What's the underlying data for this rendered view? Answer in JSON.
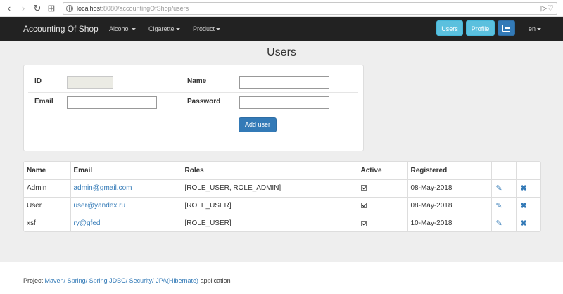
{
  "browser": {
    "back_glyph": "‹",
    "forward_glyph": "›",
    "reload_glyph": "↻",
    "tabs_glyph": "⊞",
    "url_host": "localhost",
    "url_rest": ":8080/accountingOfShop/users",
    "send_glyph": "▷",
    "heart_glyph": "♡"
  },
  "navbar": {
    "brand": "Accounting Of Shop",
    "menus": [
      "Alcohol",
      "Cigarette",
      "Product"
    ],
    "users_button": "Users",
    "profile_button": "Profile",
    "logout_icon": "logout-icon",
    "lang": "en"
  },
  "page": {
    "title": "Users"
  },
  "form": {
    "id_label": "ID",
    "id_value": "",
    "name_label": "Name",
    "name_value": "",
    "email_label": "Email",
    "email_value": "",
    "password_label": "Password",
    "password_value": "",
    "add_button": "Add user"
  },
  "table": {
    "headers": [
      "Name",
      "Email",
      "Roles",
      "Active",
      "Registered",
      "",
      ""
    ],
    "rows": [
      {
        "name": "Admin",
        "email": "admin@gmail.com",
        "roles": "[ROLE_USER, ROLE_ADMIN]",
        "active": true,
        "registered": "08-May-2018"
      },
      {
        "name": "User",
        "email": "user@yandex.ru",
        "roles": "[ROLE_USER]",
        "active": true,
        "registered": "08-May-2018"
      },
      {
        "name": "xsf",
        "email": "ry@gfed",
        "roles": "[ROLE_USER]",
        "active": true,
        "registered": "10-May-2018"
      }
    ],
    "edit_icon": "pencil-icon",
    "delete_icon": "close-icon"
  },
  "footer": {
    "prefix": "Project",
    "links": [
      "Maven/",
      "Spring/",
      "Spring JDBC/",
      "Security/",
      "JPA(Hibernate)"
    ],
    "suffix": "application"
  },
  "colors": {
    "navbar_bg": "#222222",
    "content_bg": "#eeeeee",
    "primary": "#337ab7",
    "info": "#5bc0de"
  }
}
